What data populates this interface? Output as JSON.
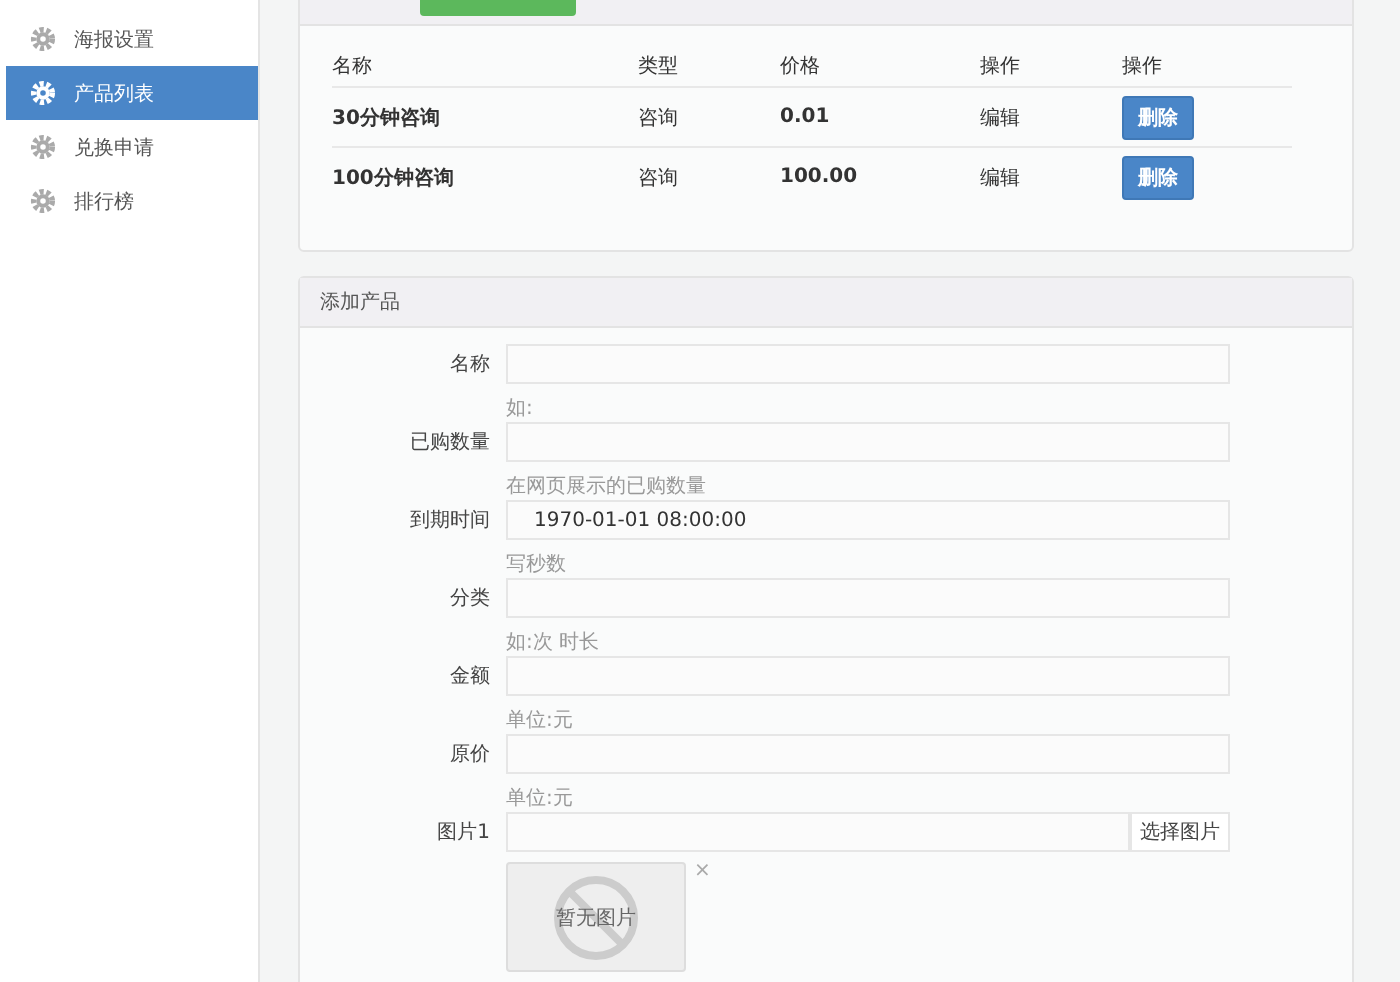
{
  "sidebar": {
    "items": [
      {
        "label": "海报设置",
        "selected": false
      },
      {
        "label": "产品列表",
        "selected": true
      },
      {
        "label": "兑换申请",
        "selected": false
      },
      {
        "label": "排行榜",
        "selected": false
      }
    ]
  },
  "product_list": {
    "columns": [
      "名称",
      "类型",
      "价格",
      "操作",
      "操作"
    ],
    "rows": [
      {
        "cells": [
          "30分钟咨询",
          "咨询",
          "0.01",
          "编辑"
        ],
        "action": "删除"
      },
      {
        "cells": [
          "100分钟咨询",
          "咨询",
          "100.00",
          "编辑"
        ],
        "action": "删除"
      }
    ]
  },
  "add_form": {
    "title": "添加产品",
    "fields": [
      {
        "kind": "text",
        "label": "名称",
        "help": "如:"
      },
      {
        "kind": "text",
        "label": "已购数量",
        "help": "在网页展示的已购数量"
      },
      {
        "kind": "text",
        "label": "到期时间",
        "value": "1970-01-01 08:00:00",
        "help": "写秒数"
      },
      {
        "kind": "text",
        "label": "分类",
        "help": "如:次 时长"
      },
      {
        "kind": "text",
        "label": "金额",
        "help": "单位:元"
      },
      {
        "kind": "text",
        "label": "原价",
        "help": "单位:元"
      },
      {
        "kind": "image",
        "label": "图片1",
        "button": "选择图片",
        "preview": "暂无图片",
        "remove": "×"
      }
    ]
  }
}
